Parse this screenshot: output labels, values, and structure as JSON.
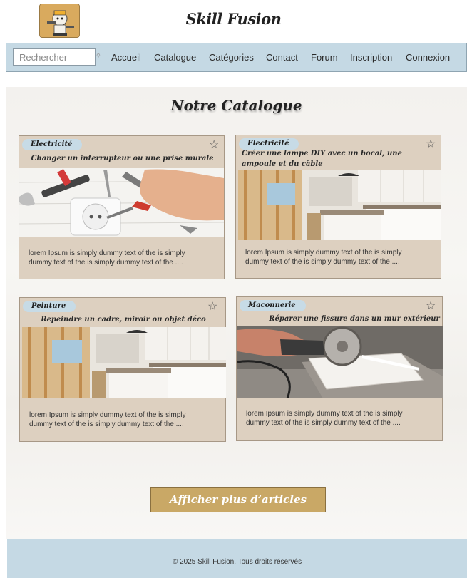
{
  "header": {
    "title": "Skill Fusion",
    "logo_icon": "handyman-mascot-icon"
  },
  "nav": {
    "search_placeholder": "Rechercher",
    "items": [
      "Accueil",
      "Catalogue",
      "Catégories",
      "Contact",
      "Forum",
      "Inscription",
      "Connexion"
    ]
  },
  "main": {
    "title": "Notre Catalogue"
  },
  "cards": [
    {
      "tag": "Electricité",
      "title": "Changer un interrupteur ou une prise murale",
      "text": "lorem Ipsum is simply dummy text of the  is simply dummy text of the  is simply dummy text of the  ....",
      "image": "tools-outlet-photo"
    },
    {
      "tag": "Electricité",
      "title": "Créer une lampe DIY avec un bocal, une ampoule et du câble",
      "text": "lorem Ipsum is simply dummy text of the  is simply dummy text of the  is simply dummy text of the  ....",
      "image": "kitchen-renovation-photo"
    },
    {
      "tag": "Peinture",
      "title": "Repeindre un cadre, miroir ou objet déco",
      "text": "lorem Ipsum is simply dummy text of the  is simply dummy text of the  is simply dummy text of the  ....",
      "image": "kitchen-renovation-photo"
    },
    {
      "tag": "Maconnerie",
      "title": "Réparer une fissure dans un mur extérieur",
      "text": "lorem Ipsum is simply dummy text of the  is simply dummy text of the  is simply dummy text of the  ....",
      "image": "tile-cutting-photo"
    }
  ],
  "more_button": "Afficher plus d’articles",
  "footer": {
    "text": "© 2025 Skill Fusion. Tous droits réservés"
  },
  "colors": {
    "nav_bg": "#c5d9e4",
    "card_bg": "#ddd0c0",
    "button_bg": "#c9a866",
    "tag_bg": "#c7dbe6"
  }
}
